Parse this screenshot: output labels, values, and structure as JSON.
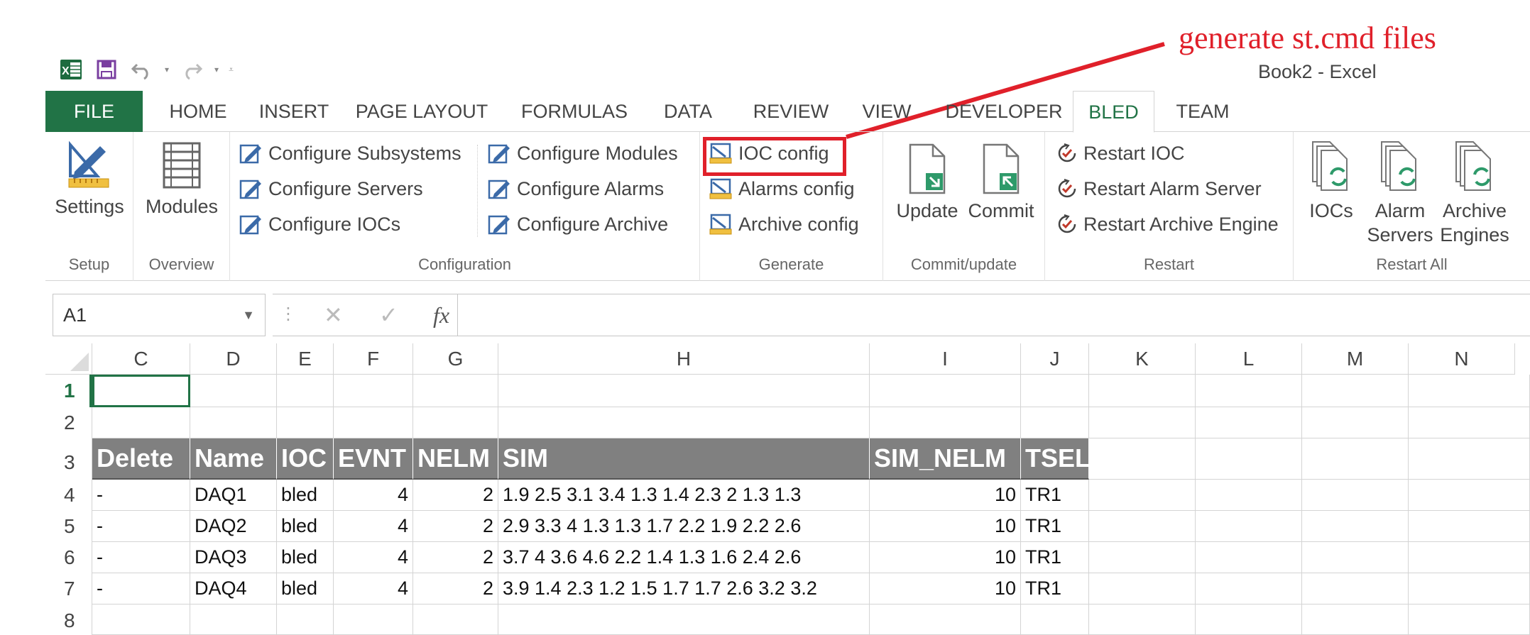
{
  "window": {
    "title": "Book2 - Excel"
  },
  "annotation": {
    "text": "generate st.cmd files",
    "color": "#e0202a"
  },
  "colors": {
    "accent": "#217346",
    "header_fill": "#808080",
    "highlight": "#e0202a"
  },
  "quick_access": {
    "icons": [
      "excel-logo-icon",
      "save-icon",
      "undo-icon",
      "redo-icon",
      "customize-qat-icon"
    ],
    "excel_logo_text": "X"
  },
  "tabs": [
    "FILE",
    "HOME",
    "INSERT",
    "PAGE LAYOUT",
    "FORMULAS",
    "DATA",
    "REVIEW",
    "VIEW",
    "DEVELOPER",
    "BLED",
    "TEAM"
  ],
  "active_tab": "BLED",
  "ribbon": {
    "setup": {
      "label": "Setup",
      "settings": "Settings"
    },
    "overview": {
      "label": "Overview",
      "modules": "Modules"
    },
    "configuration": {
      "label": "Configuration",
      "col1": [
        "Configure Subsystems",
        "Configure Servers",
        "Configure IOCs"
      ],
      "col2": [
        "Configure Modules",
        "Configure Alarms",
        "Configure Archive"
      ]
    },
    "generate": {
      "label": "Generate",
      "items": [
        "IOC config",
        "Alarms config",
        "Archive config"
      ]
    },
    "commit_update": {
      "label": "Commit/update",
      "update": "Update",
      "commit": "Commit"
    },
    "restart": {
      "label": "Restart",
      "items": [
        "Restart IOC",
        "Restart Alarm Server",
        "Restart Archive Engine"
      ]
    },
    "restart_all": {
      "label": "Restart All",
      "iocs": "IOCs",
      "alarm_servers": [
        "Alarm",
        "Servers"
      ],
      "archive_engines": [
        "Archive",
        "Engines"
      ]
    }
  },
  "formula_bar": {
    "name_box": "A1",
    "fx": "fx",
    "dots": "⋮",
    "formula": ""
  },
  "sheet": {
    "columns": [
      "C",
      "D",
      "E",
      "F",
      "G",
      "H",
      "I",
      "J",
      "K",
      "L",
      "M",
      "N"
    ],
    "rows": [
      "1",
      "2",
      "3",
      "4",
      "5",
      "6",
      "7",
      "8"
    ],
    "table_header": [
      "Delete",
      "Name",
      "IOC",
      "EVNT",
      "NELM",
      "SIM",
      "SIM_NELM",
      "TSEL"
    ],
    "table_rows": [
      [
        "-",
        "DAQ1",
        "bled",
        "4",
        "2",
        "1.9 2.5 3.1 3.4 1.3 1.4 2.3 2 1.3 1.3",
        "10",
        "TR1"
      ],
      [
        "-",
        "DAQ2",
        "bled",
        "4",
        "2",
        "2.9 3.3 4 1.3 1.3 1.7 2.2 1.9 2.2 2.6",
        "10",
        "TR1"
      ],
      [
        "-",
        "DAQ3",
        "bled",
        "4",
        "2",
        "3.7 4 3.6 4.6 2.2 1.4 1.3 1.6 2.4 2.6",
        "10",
        "TR1"
      ],
      [
        "-",
        "DAQ4",
        "bled",
        "4",
        "2",
        "3.9 1.4 2.3 1.2 1.5 1.7 1.7 2.6 3.2 3.2",
        "10",
        "TR1"
      ]
    ]
  }
}
